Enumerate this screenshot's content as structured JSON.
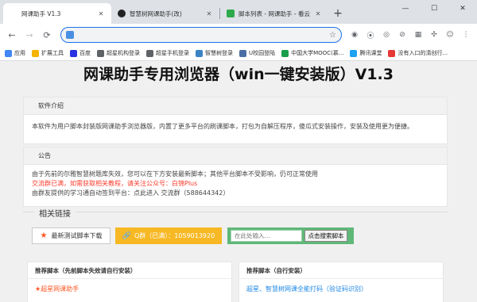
{
  "browser": {
    "tabs": [
      {
        "title": "网课助手 V1.3",
        "active": true,
        "favicon_color": "#ffffff"
      },
      {
        "title": "智慧树网课助手(改)",
        "active": false,
        "favicon_color": "#222222"
      },
      {
        "title": "脚本列表 - 网课助手 - 看云",
        "active": false,
        "favicon_color": "#2eaa4b"
      }
    ],
    "new_tab": "+",
    "window_controls": [
      "—",
      "☐",
      "✕"
    ],
    "url": "",
    "bookmarks": [
      {
        "label": "应用",
        "color": "#4285f4"
      },
      {
        "label": "扩展工具",
        "color": "#f4b400"
      },
      {
        "label": "百度",
        "color": "#2932e1"
      },
      {
        "label": "超星机构登录",
        "color": "#5f6368"
      },
      {
        "label": "超星手机登录",
        "color": "#5f6368"
      },
      {
        "label": "智慧树登录",
        "color": "#3b82c4"
      },
      {
        "label": "U校园登陆",
        "color": "#4a6fa5"
      },
      {
        "label": "中国大学MOOC(慕...",
        "color": "#1a9e4b"
      },
      {
        "label": "腾讯课堂",
        "color": "#1da1f2"
      },
      {
        "label": "没有入口的清创行...",
        "color": "#e53935"
      }
    ]
  },
  "page": {
    "title": "网课助手专用浏览器（win一键安装版）V1.3",
    "intro": {
      "heading": "软件介绍",
      "text": "本软件为用户脚本封装版网课助手浏览器版，内置了更多平台的刷课脚本，打包为自解压程序，傻瓜式安装操作，安装及使用更为便捷。"
    },
    "notice": {
      "heading": "公告",
      "line1": "由于先前的尔雅智慧树题库失效，您可以在下方安装最新脚本；其他平台脚本不受影响，仍可正常使用",
      "line2": "交流群已满，如需获取相关教程，请关注公众号：白锦Plus",
      "line3": "由群友提供的学习通自动签到平台：点此进入 交流群（588644342）"
    },
    "links": {
      "heading": "相关链接",
      "download_label": "最新测试脚本下载",
      "qq_label": "Q群（已满）：1059013920",
      "search_placeholder": "在此处输入...",
      "search_button": "点击搜索脚本"
    },
    "recommend_left": {
      "heading": "推荐脚本（先前脚本失效请自行安装）",
      "item": "超星网课助手"
    },
    "recommend_right": {
      "heading": "推荐脚本（自行安装）",
      "item": "超星、智慧树网课全能打码（验证码识别）"
    }
  }
}
